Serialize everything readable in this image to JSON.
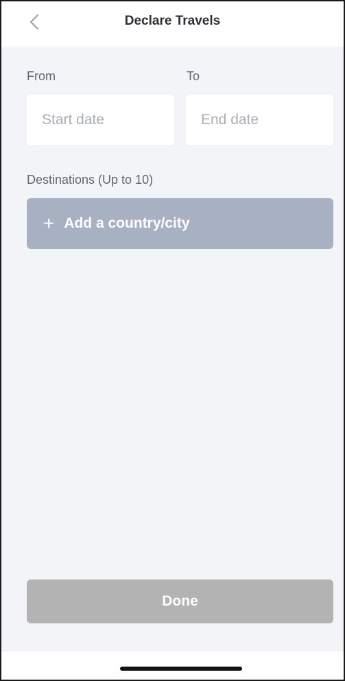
{
  "header": {
    "title": "Declare Travels",
    "back_icon": "chevron-left-icon"
  },
  "form": {
    "from_label": "From",
    "to_label": "To",
    "start_date_placeholder": "Start date",
    "end_date_placeholder": "End date",
    "start_date_value": "",
    "end_date_value": "",
    "destinations_label": "Destinations (Up to 10)",
    "add_destination_icon": "plus-icon",
    "add_destination_label": "Add a country/city"
  },
  "footer": {
    "done_label": "Done"
  },
  "colors": {
    "background": "#f3f4f8",
    "add_button": "#a7b1c2",
    "done_button_disabled": "#b3b3b3",
    "title_text": "#2b2f36"
  }
}
